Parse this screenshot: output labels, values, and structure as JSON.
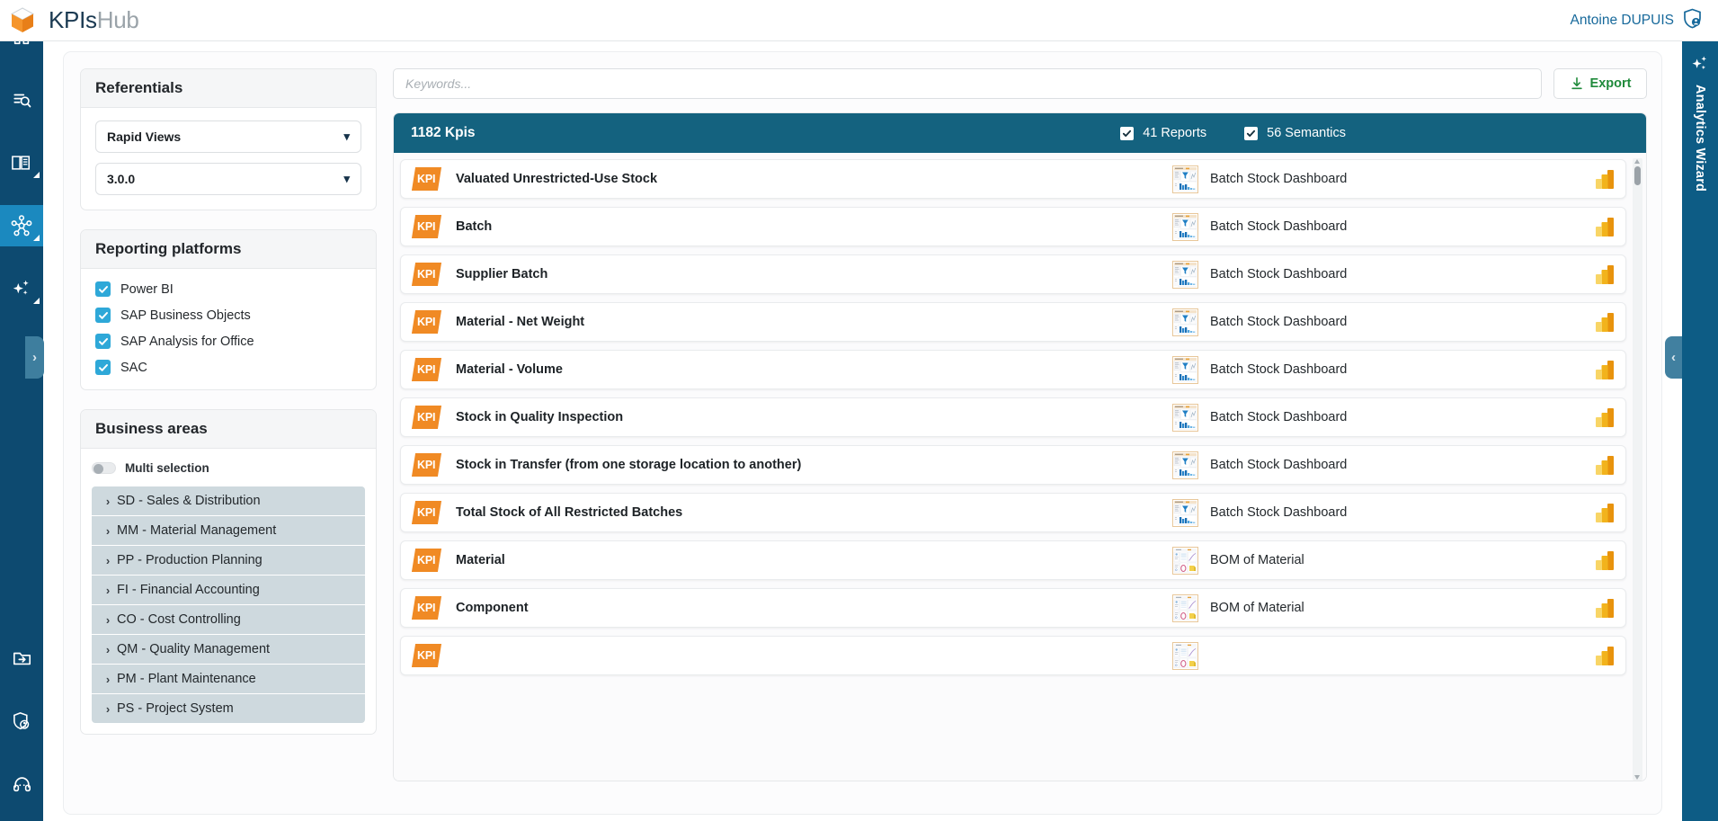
{
  "header": {
    "logo_icon": "cube-icon",
    "title_primary": "KPIs",
    "title_secondary": "Hub",
    "user_name": "Antoine DUPUIS",
    "user_icon": "shield-user-icon"
  },
  "left_rail": {
    "items": [
      {
        "icon": "home-icon",
        "active": false
      },
      {
        "icon": "search-list-icon",
        "active": false
      },
      {
        "icon": "book-icon",
        "active": false
      },
      {
        "icon": "network-hub-icon",
        "active": true
      },
      {
        "icon": "sparkles-icon",
        "active": false
      }
    ],
    "bottom_items": [
      {
        "icon": "folder-export-icon"
      },
      {
        "icon": "shield-user-icon"
      },
      {
        "icon": "headset-support-icon"
      }
    ]
  },
  "right_rail": {
    "label": "Analytics Wizard",
    "icon": "sparkles-icon"
  },
  "handles": {
    "left_icon": "chevron-right-icon",
    "right_icon": "chevron-left-icon"
  },
  "filters": {
    "referentials": {
      "title": "Referentials",
      "selects": [
        {
          "name": "referential-select",
          "value": "Rapid Views"
        },
        {
          "name": "version-select",
          "value": "3.0.0"
        }
      ]
    },
    "reporting_platforms": {
      "title": "Reporting platforms",
      "items": [
        {
          "label": "Power BI",
          "checked": true
        },
        {
          "label": "SAP Business Objects",
          "checked": true
        },
        {
          "label": "SAP Analysis for Office",
          "checked": true
        },
        {
          "label": "SAC",
          "checked": true
        }
      ]
    },
    "business_areas": {
      "title": "Business areas",
      "multi_selection_label": "Multi selection",
      "multi_selection_on": false,
      "items": [
        "SD - Sales & Distribution",
        "MM - Material Management",
        "PP - Production Planning",
        "FI - Financial Accounting",
        "CO - Cost Controlling",
        "QM - Quality Management",
        "PM - Plant Maintenance",
        "PS - Project System"
      ]
    }
  },
  "main": {
    "search": {
      "value": "",
      "placeholder": "Keywords..."
    },
    "export_button": {
      "label": "Export",
      "icon": "download-icon"
    },
    "list_header": {
      "count_label": "1182 Kpis",
      "reports_checkbox": {
        "label": "41 Reports",
        "checked": true
      },
      "semantics_checkbox": {
        "label": "56 Semantics",
        "checked": true
      }
    },
    "rows": [
      {
        "badge": "KPI",
        "name": "Valuated Unrestricted-Use Stock",
        "report": "Batch Stock Dashboard",
        "thumb": "batch-stock",
        "platform_icon": "powerbi-icon"
      },
      {
        "badge": "KPI",
        "name": "Batch",
        "report": "Batch Stock Dashboard",
        "thumb": "batch-stock",
        "platform_icon": "powerbi-icon"
      },
      {
        "badge": "KPI",
        "name": "Supplier Batch",
        "report": "Batch Stock Dashboard",
        "thumb": "batch-stock",
        "platform_icon": "powerbi-icon"
      },
      {
        "badge": "KPI",
        "name": "Material - Net Weight",
        "report": "Batch Stock Dashboard",
        "thumb": "batch-stock",
        "platform_icon": "powerbi-icon"
      },
      {
        "badge": "KPI",
        "name": "Material - Volume",
        "report": "Batch Stock Dashboard",
        "thumb": "batch-stock",
        "platform_icon": "powerbi-icon"
      },
      {
        "badge": "KPI",
        "name": "Stock in Quality Inspection",
        "report": "Batch Stock Dashboard",
        "thumb": "batch-stock",
        "platform_icon": "powerbi-icon"
      },
      {
        "badge": "KPI",
        "name": "Stock in Transfer (from one storage location to another)",
        "report": "Batch Stock Dashboard",
        "thumb": "batch-stock",
        "platform_icon": "powerbi-icon"
      },
      {
        "badge": "KPI",
        "name": "Total Stock of All Restricted Batches",
        "report": "Batch Stock Dashboard",
        "thumb": "batch-stock",
        "platform_icon": "powerbi-icon"
      },
      {
        "badge": "KPI",
        "name": "Material",
        "report": "BOM of Material",
        "thumb": "bom",
        "platform_icon": "powerbi-icon"
      },
      {
        "badge": "KPI",
        "name": "Component",
        "report": "BOM of Material",
        "thumb": "bom",
        "platform_icon": "powerbi-icon"
      },
      {
        "badge": "KPI",
        "name": "",
        "report": "",
        "thumb": "bom",
        "platform_icon": "powerbi-icon"
      }
    ]
  },
  "colors": {
    "rail": "#0d4a70",
    "rail_active": "#1b89bf",
    "list_header": "#14627f",
    "accent_orange": "#f08a24",
    "checkbox_blue": "#2ea8d8",
    "export_green": "#1f8a3b",
    "user_blue": "#17699b"
  }
}
